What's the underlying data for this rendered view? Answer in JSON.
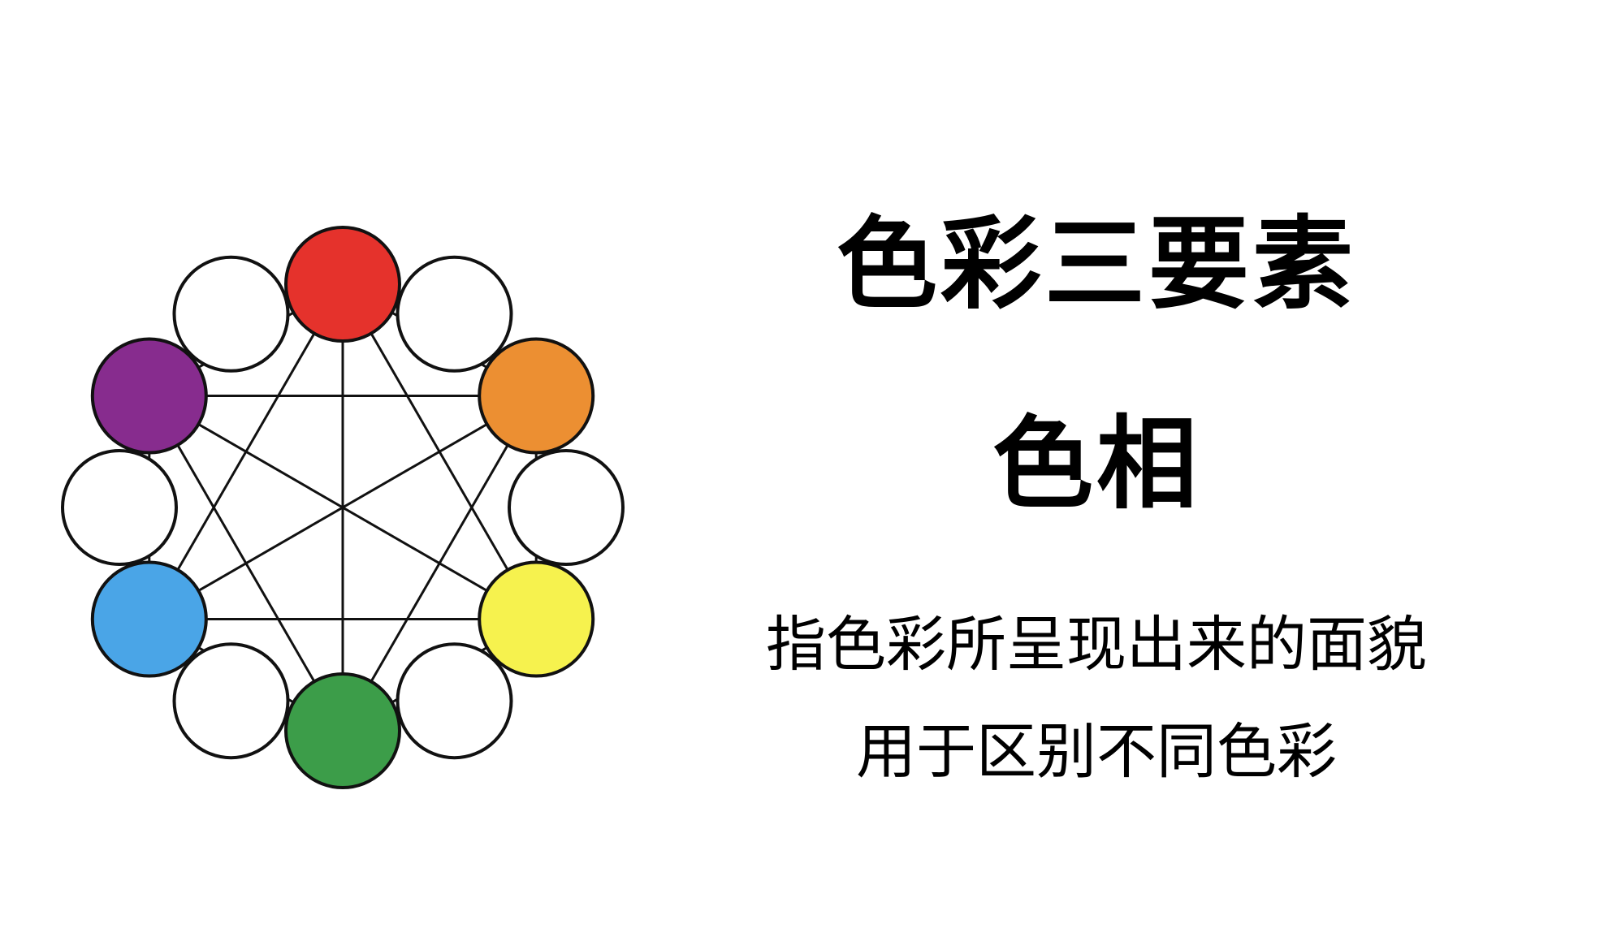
{
  "title": "色彩三要素",
  "subtitle": "色相",
  "description": [
    "指色彩所呈现出来的面貌",
    "用于区别不同色彩"
  ],
  "wheel": {
    "stroke_color": "#111111",
    "circles": [
      {
        "name": "red-circle",
        "color": "#e5322c"
      },
      {
        "name": "white-circle-1",
        "color": "#ffffff"
      },
      {
        "name": "orange-circle",
        "color": "#ec8f32"
      },
      {
        "name": "white-circle-2",
        "color": "#ffffff"
      },
      {
        "name": "yellow-circle",
        "color": "#f6f24e"
      },
      {
        "name": "white-circle-3",
        "color": "#ffffff"
      },
      {
        "name": "green-circle",
        "color": "#3c9d49"
      },
      {
        "name": "white-circle-4",
        "color": "#ffffff"
      },
      {
        "name": "blue-circle",
        "color": "#4aa5e7"
      },
      {
        "name": "white-circle-5",
        "color": "#ffffff"
      },
      {
        "name": "purple-circle",
        "color": "#872c8e"
      },
      {
        "name": "white-circle-6",
        "color": "#ffffff"
      }
    ]
  }
}
